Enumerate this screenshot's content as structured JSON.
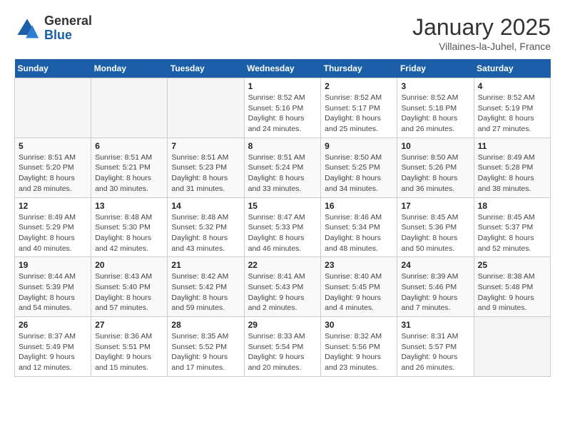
{
  "header": {
    "logo_general": "General",
    "logo_blue": "Blue",
    "month_title": "January 2025",
    "subtitle": "Villaines-la-Juhel, France"
  },
  "weekdays": [
    "Sunday",
    "Monday",
    "Tuesday",
    "Wednesday",
    "Thursday",
    "Friday",
    "Saturday"
  ],
  "weeks": [
    [
      {
        "day": "",
        "info": ""
      },
      {
        "day": "",
        "info": ""
      },
      {
        "day": "",
        "info": ""
      },
      {
        "day": "1",
        "info": "Sunrise: 8:52 AM\nSunset: 5:16 PM\nDaylight: 8 hours and 24 minutes."
      },
      {
        "day": "2",
        "info": "Sunrise: 8:52 AM\nSunset: 5:17 PM\nDaylight: 8 hours and 25 minutes."
      },
      {
        "day": "3",
        "info": "Sunrise: 8:52 AM\nSunset: 5:18 PM\nDaylight: 8 hours and 26 minutes."
      },
      {
        "day": "4",
        "info": "Sunrise: 8:52 AM\nSunset: 5:19 PM\nDaylight: 8 hours and 27 minutes."
      }
    ],
    [
      {
        "day": "5",
        "info": "Sunrise: 8:51 AM\nSunset: 5:20 PM\nDaylight: 8 hours and 28 minutes."
      },
      {
        "day": "6",
        "info": "Sunrise: 8:51 AM\nSunset: 5:21 PM\nDaylight: 8 hours and 30 minutes."
      },
      {
        "day": "7",
        "info": "Sunrise: 8:51 AM\nSunset: 5:23 PM\nDaylight: 8 hours and 31 minutes."
      },
      {
        "day": "8",
        "info": "Sunrise: 8:51 AM\nSunset: 5:24 PM\nDaylight: 8 hours and 33 minutes."
      },
      {
        "day": "9",
        "info": "Sunrise: 8:50 AM\nSunset: 5:25 PM\nDaylight: 8 hours and 34 minutes."
      },
      {
        "day": "10",
        "info": "Sunrise: 8:50 AM\nSunset: 5:26 PM\nDaylight: 8 hours and 36 minutes."
      },
      {
        "day": "11",
        "info": "Sunrise: 8:49 AM\nSunset: 5:28 PM\nDaylight: 8 hours and 38 minutes."
      }
    ],
    [
      {
        "day": "12",
        "info": "Sunrise: 8:49 AM\nSunset: 5:29 PM\nDaylight: 8 hours and 40 minutes."
      },
      {
        "day": "13",
        "info": "Sunrise: 8:48 AM\nSunset: 5:30 PM\nDaylight: 8 hours and 42 minutes."
      },
      {
        "day": "14",
        "info": "Sunrise: 8:48 AM\nSunset: 5:32 PM\nDaylight: 8 hours and 43 minutes."
      },
      {
        "day": "15",
        "info": "Sunrise: 8:47 AM\nSunset: 5:33 PM\nDaylight: 8 hours and 46 minutes."
      },
      {
        "day": "16",
        "info": "Sunrise: 8:46 AM\nSunset: 5:34 PM\nDaylight: 8 hours and 48 minutes."
      },
      {
        "day": "17",
        "info": "Sunrise: 8:45 AM\nSunset: 5:36 PM\nDaylight: 8 hours and 50 minutes."
      },
      {
        "day": "18",
        "info": "Sunrise: 8:45 AM\nSunset: 5:37 PM\nDaylight: 8 hours and 52 minutes."
      }
    ],
    [
      {
        "day": "19",
        "info": "Sunrise: 8:44 AM\nSunset: 5:39 PM\nDaylight: 8 hours and 54 minutes."
      },
      {
        "day": "20",
        "info": "Sunrise: 8:43 AM\nSunset: 5:40 PM\nDaylight: 8 hours and 57 minutes."
      },
      {
        "day": "21",
        "info": "Sunrise: 8:42 AM\nSunset: 5:42 PM\nDaylight: 8 hours and 59 minutes."
      },
      {
        "day": "22",
        "info": "Sunrise: 8:41 AM\nSunset: 5:43 PM\nDaylight: 9 hours and 2 minutes."
      },
      {
        "day": "23",
        "info": "Sunrise: 8:40 AM\nSunset: 5:45 PM\nDaylight: 9 hours and 4 minutes."
      },
      {
        "day": "24",
        "info": "Sunrise: 8:39 AM\nSunset: 5:46 PM\nDaylight: 9 hours and 7 minutes."
      },
      {
        "day": "25",
        "info": "Sunrise: 8:38 AM\nSunset: 5:48 PM\nDaylight: 9 hours and 9 minutes."
      }
    ],
    [
      {
        "day": "26",
        "info": "Sunrise: 8:37 AM\nSunset: 5:49 PM\nDaylight: 9 hours and 12 minutes."
      },
      {
        "day": "27",
        "info": "Sunrise: 8:36 AM\nSunset: 5:51 PM\nDaylight: 9 hours and 15 minutes."
      },
      {
        "day": "28",
        "info": "Sunrise: 8:35 AM\nSunset: 5:52 PM\nDaylight: 9 hours and 17 minutes."
      },
      {
        "day": "29",
        "info": "Sunrise: 8:33 AM\nSunset: 5:54 PM\nDaylight: 9 hours and 20 minutes."
      },
      {
        "day": "30",
        "info": "Sunrise: 8:32 AM\nSunset: 5:56 PM\nDaylight: 9 hours and 23 minutes."
      },
      {
        "day": "31",
        "info": "Sunrise: 8:31 AM\nSunset: 5:57 PM\nDaylight: 9 hours and 26 minutes."
      },
      {
        "day": "",
        "info": ""
      }
    ]
  ]
}
